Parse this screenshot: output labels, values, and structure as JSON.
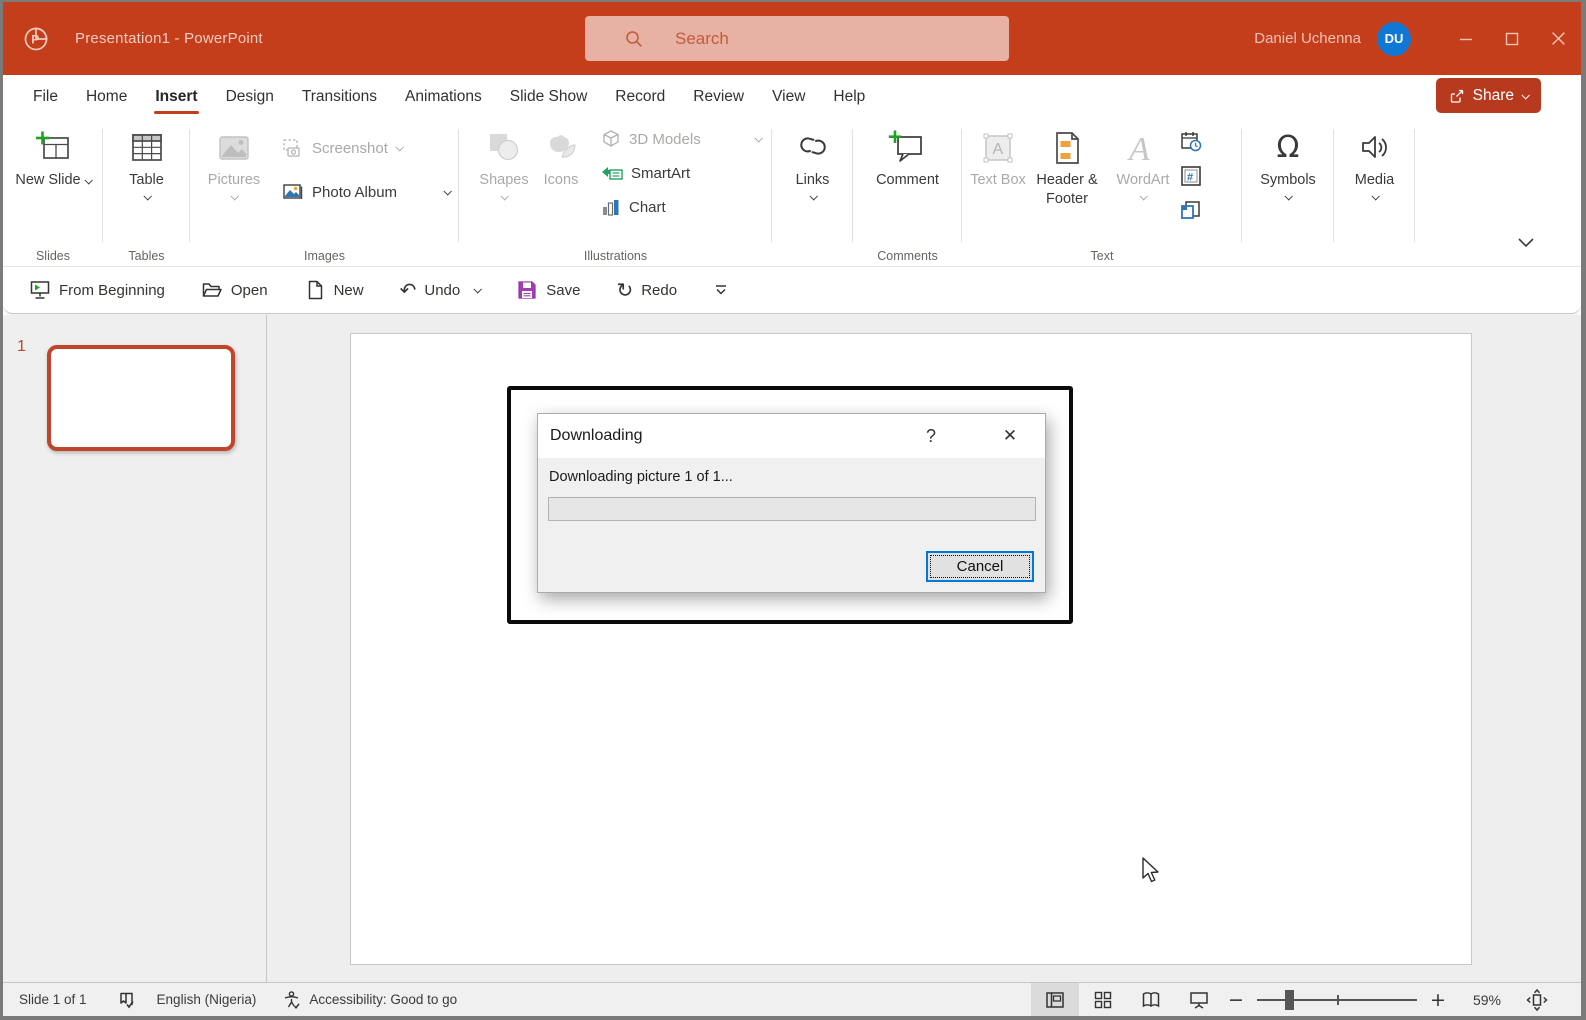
{
  "window": {
    "title": "Presentation1  -  PowerPoint",
    "search_placeholder": "Search",
    "user_name": "Daniel Uchenna",
    "user_initials": "DU"
  },
  "menubar": {
    "tabs": [
      "File",
      "Home",
      "Insert",
      "Design",
      "Transitions",
      "Animations",
      "Slide Show",
      "Record",
      "Review",
      "View",
      "Help"
    ],
    "active_tab": "Insert",
    "share_label": "Share"
  },
  "qat": {
    "from_beginning": "From Beginning",
    "open": "Open",
    "new": "New",
    "undo": "Undo",
    "save": "Save",
    "redo": "Redo"
  },
  "ribbon": {
    "slides": {
      "group": "Slides",
      "new_slide": "New Slide"
    },
    "tables": {
      "group": "Tables",
      "table": "Table"
    },
    "images": {
      "group": "Images",
      "pictures": "Pictures",
      "screenshot": "Screenshot",
      "photo_album": "Photo Album"
    },
    "illustrations": {
      "group": "Illustrations",
      "shapes": "Shapes",
      "icons": "Icons",
      "models": "3D Models",
      "smartart": "SmartArt",
      "chart": "Chart"
    },
    "links": {
      "links": "Links"
    },
    "comments": {
      "group": "Comments",
      "comment": "Comment"
    },
    "text": {
      "group": "Text",
      "text_box": "Text Box",
      "header_footer": "Header & Footer",
      "wordart": "WordArt"
    },
    "symbols": {
      "symbols": "Symbols"
    },
    "media": {
      "media": "Media"
    }
  },
  "slides_panel": {
    "slide_number": "1"
  },
  "dialog": {
    "title": "Downloading",
    "help_glyph": "?",
    "message": "Downloading picture 1 of 1...",
    "progress_percent": 0,
    "cancel": "Cancel"
  },
  "statusbar": {
    "slide_info": "Slide 1 of 1",
    "language": "English (Nigeria)",
    "accessibility": "Accessibility: Good to go",
    "zoom": "59%"
  },
  "colors": {
    "titlebar": "#C43E1C",
    "accent": "#C43E1C",
    "avatar_blue": "#1078D4",
    "share_button": "#B83A1E",
    "save_icon_purple": "#A23FB0",
    "focus_blue": "#0078D7"
  }
}
